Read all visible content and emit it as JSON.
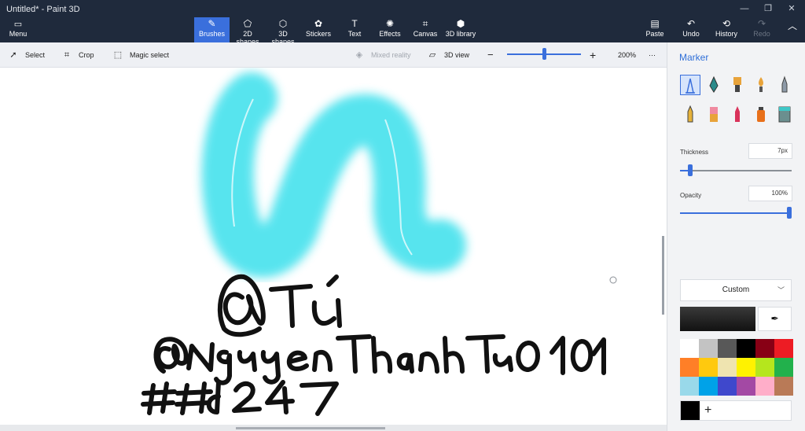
{
  "window": {
    "title": "Untitled* - Paint 3D"
  },
  "ribbon": {
    "menu_label": "Menu",
    "tools": [
      {
        "label": "Brushes",
        "icon": "brush-icon",
        "glyph": "✎"
      },
      {
        "label": "2D shapes",
        "icon": "2d-shapes-icon",
        "glyph": "⬠"
      },
      {
        "label": "3D shapes",
        "icon": "3d-shapes-icon",
        "glyph": "⬡"
      },
      {
        "label": "Stickers",
        "icon": "stickers-icon",
        "glyph": "✿"
      },
      {
        "label": "Text",
        "icon": "text-icon",
        "glyph": "T"
      },
      {
        "label": "Effects",
        "icon": "effects-icon",
        "glyph": "✺"
      },
      {
        "label": "Canvas",
        "icon": "canvas-icon",
        "glyph": "⌗"
      },
      {
        "label": "3D library",
        "icon": "3d-library-icon",
        "glyph": "⬢"
      }
    ],
    "actions": [
      {
        "label": "Paste",
        "icon": "paste-icon",
        "glyph": "📋"
      },
      {
        "label": "Undo",
        "icon": "undo-icon",
        "glyph": "↶"
      },
      {
        "label": "History",
        "icon": "history-icon",
        "glyph": "⟲"
      },
      {
        "label": "Redo",
        "icon": "redo-icon",
        "glyph": "↷"
      }
    ]
  },
  "toolbar": {
    "select_label": "Select",
    "crop_label": "Crop",
    "magic_select_label": "Magic select",
    "mixed_reality_label": "Mixed reality",
    "view_3d_label": "3D view",
    "zoom_percent": "200%",
    "zoom_fraction": 0.5
  },
  "canvas": {
    "ink_color": "#111111",
    "brush_color": "#4fe3ee"
  },
  "panel": {
    "title": "Marker",
    "thickness_label": "Thickness",
    "thickness_value": "7px",
    "thickness_fraction": 0.07,
    "opacity_label": "Opacity",
    "opacity_value": "100%",
    "opacity_fraction": 1.0,
    "color_mode": "Custom",
    "current_color": "#111111",
    "accent_color": "#3a6fdc",
    "swatches": [
      "#ffffff",
      "#c3c3c3",
      "#585858",
      "#000000",
      "#880015",
      "#ed1c24",
      "#ff7f27",
      "#ffc90e",
      "#efe4b0",
      "#fff200",
      "#b5e61d",
      "#22b14c",
      "#99d9ea",
      "#00a2e8",
      "#3f48cc",
      "#a349a4",
      "#ffaec9",
      "#b97a57"
    ]
  }
}
